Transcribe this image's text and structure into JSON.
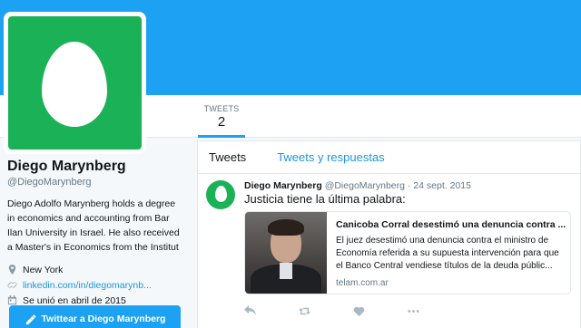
{
  "profile": {
    "name": "Diego Marynberg",
    "handle": "@DiegoMarynberg",
    "bio": "Diego Adolfo Marynberg holds a degree in economics and accounting from Bar Ilan University in Israel. He also received a Master's in Economics from the Institut",
    "location": "New York",
    "website": "linkedin.com/in/diegomarynb...",
    "joined": "Se unió en abril de 2015"
  },
  "stats": {
    "tweets_label": "TWEETS",
    "tweets_value": "2"
  },
  "cta": {
    "label": "Twittear a Diego Marynberg"
  },
  "tabs": {
    "tweets": "Tweets",
    "replies": "Tweets y respuestas"
  },
  "tweet": {
    "name": "Diego Marynberg",
    "meta": "@DiegoMarynberg · 24 sept. 2015",
    "text": "Justicia tiene la última palabra:",
    "card_title": "Canicoba Corral desestimó una denuncia contra ...",
    "card_desc": "El juez desestimó una denuncia contra el ministro de Economía referida a su supuesta intervención para que el Banco Central vendiese títulos de la deuda públic...",
    "card_domain": "telam.com.ar"
  },
  "colors": {
    "brand": "#1da1f2",
    "avatar_bg": "#1ab157",
    "link": "#1b95e0"
  },
  "icons": {
    "location": "location-pin-icon",
    "link": "link-icon",
    "calendar": "calendar-icon",
    "compose": "compose-icon",
    "reply": "reply-icon",
    "retweet": "retweet-icon",
    "like": "heart-icon",
    "more": "more-icon"
  }
}
